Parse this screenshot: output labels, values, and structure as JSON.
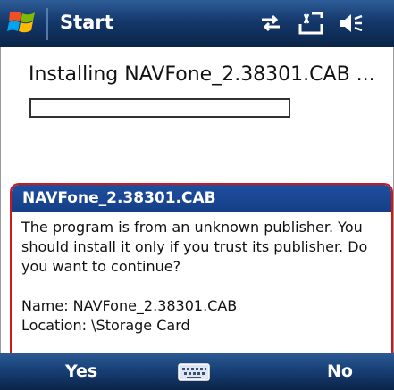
{
  "taskbar": {
    "start_label": "Start",
    "icons": [
      "start-flag-icon",
      "connectivity-icon",
      "signal-off-icon",
      "volume-off-icon"
    ]
  },
  "install": {
    "status_text": "Installing NAVFone_2.38301.CAB ...",
    "progress": 0
  },
  "dialog": {
    "title": "NAVFone_2.38301.CAB",
    "message": "The program is from an unknown publisher. You should install it only if you trust its publisher. Do you want to continue?",
    "name_line": "Name: NAVFone_2.38301.CAB",
    "location_line": "Location: \\Storage Card"
  },
  "softkeys": {
    "left_label": "Yes",
    "right_label": "No",
    "center_icon": "keyboard-icon"
  },
  "colors": {
    "bar_blue": "#14386b",
    "dialog_title_blue": "#1f4fa0",
    "dialog_border_red": "#d01818"
  }
}
